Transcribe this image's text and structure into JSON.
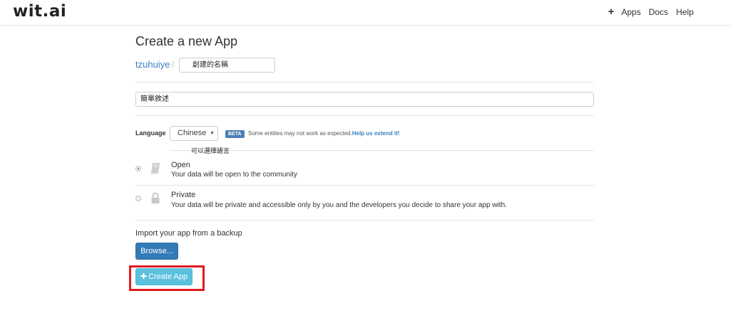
{
  "nav": {
    "logo": "wit.ai",
    "plus_glyph": "+",
    "links": [
      "Apps",
      "Docs",
      "Help"
    ]
  },
  "page": {
    "title": "Create a new App"
  },
  "form": {
    "owner": "tzuhuiye",
    "separator": "/",
    "app_name_value": "創建的名稱",
    "description_value": "簡單敘述",
    "language_label": "Language",
    "language_selected": "Chinese",
    "beta_badge": "BETA",
    "beta_note": "Some entities may not work as expected.",
    "beta_help_link": "Help us extend it!",
    "language_annotation": "可以選擇語言",
    "visibility_options": [
      {
        "title": "Open",
        "description": "Your data will be open to the community",
        "selected": true,
        "icon": "book-icon"
      },
      {
        "title": "Private",
        "description": "Your data will be private and accessible only by you and the developers you decide to share your app with.",
        "selected": false,
        "icon": "lock-icon"
      }
    ],
    "import_label": "Import your app from a backup",
    "browse_label": "Browse...",
    "create_label": "Create App",
    "create_plus": "✚"
  },
  "colors": {
    "link": "#3a7fc1",
    "primary_button": "#337ab7",
    "info_button": "#5bc0de",
    "beta_badge": "#4a7fb5",
    "highlight": "#e0191f"
  }
}
